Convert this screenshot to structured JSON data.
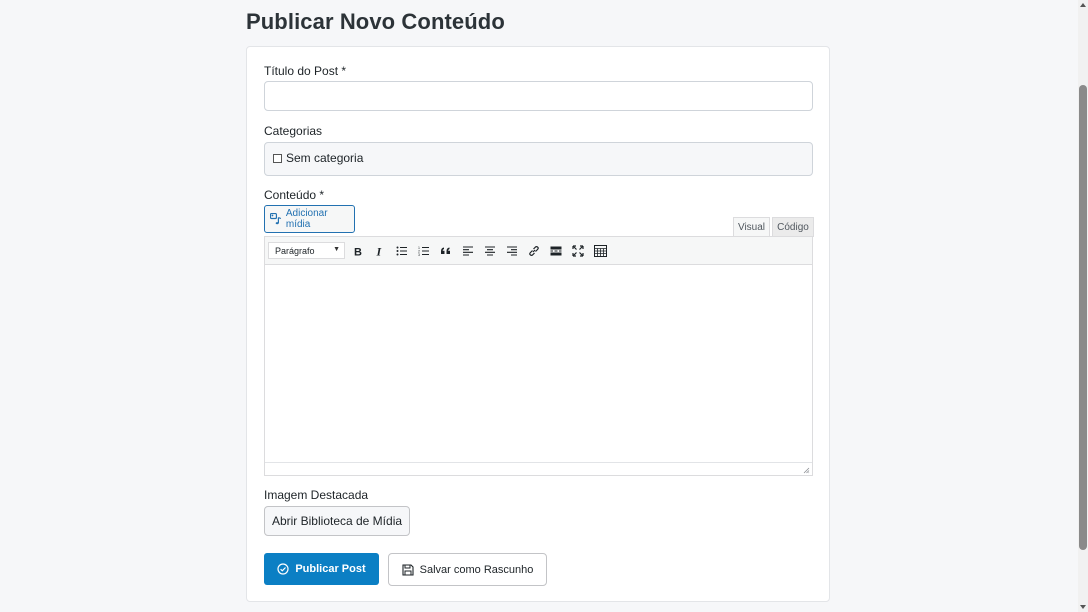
{
  "page": {
    "title": "Publicar Novo Conteúdo"
  },
  "form": {
    "title_label": "Título do Post *",
    "title_value": "",
    "categories_label": "Categorias",
    "categories": [
      {
        "label": "Sem categoria",
        "checked": false
      }
    ],
    "content_label": "Conteúdo *",
    "add_media_label": "Adicionar mídia",
    "tabs": {
      "visual": "Visual",
      "code": "Código"
    },
    "format_select": "Parágrafo",
    "featured_image_label": "Imagem Destacada",
    "media_library_button": "Abrir Biblioteca de Mídia",
    "publish_button": "Publicar Post",
    "draft_button": "Salvar como Rascunho"
  },
  "toolbar_icons": [
    "bold-icon",
    "italic-icon",
    "bullet-list-icon",
    "numbered-list-icon",
    "blockquote-icon",
    "align-left-icon",
    "align-center-icon",
    "align-right-icon",
    "link-icon",
    "read-more-icon",
    "fullscreen-icon",
    "toolbar-toggle-icon"
  ],
  "colors": {
    "primary": "#0b7fc4",
    "link": "#2271b1",
    "border": "#cfd4da"
  }
}
